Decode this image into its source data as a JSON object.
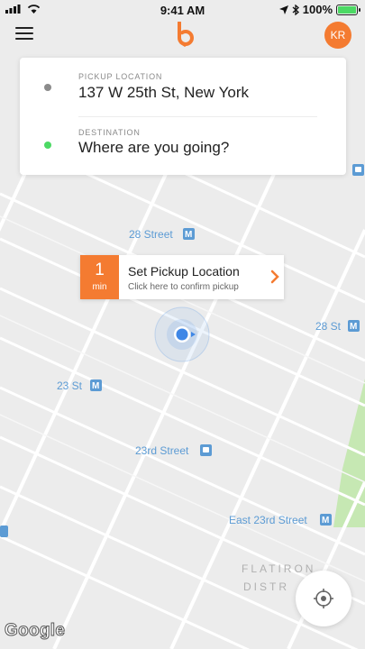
{
  "status_bar": {
    "time": "9:41 AM",
    "battery_percent": "100%",
    "battery_level": 1.0
  },
  "nav": {
    "menu_icon": "hamburger-icon",
    "logo_icon": "b-logo-icon",
    "avatar_initials": "KR",
    "brand_color": "#f47b31"
  },
  "location_card": {
    "pickup": {
      "label": "PICKUP LOCATION",
      "value": "137 W 25th St, New York",
      "dot_color": "#8b8b8b"
    },
    "destination": {
      "label": "DESTINATION",
      "value": "Where are you going?",
      "dot_color": "#4cd964"
    }
  },
  "pickup_callout": {
    "eta_number": "1",
    "eta_unit": "min",
    "title": "Set Pickup Location",
    "subtitle": "Click here to confirm pickup",
    "chevron_icon": "chevron-right-icon"
  },
  "map": {
    "labels": [
      {
        "text": "28 Street",
        "kind": "subway"
      },
      {
        "text": "28 St",
        "kind": "subway"
      },
      {
        "text": "23 St",
        "kind": "subway"
      },
      {
        "text": "23rd Street",
        "kind": "path"
      },
      {
        "text": "East 23rd Street",
        "kind": "subway"
      },
      {
        "text": "FLATIRON",
        "kind": "district"
      },
      {
        "text": "DISTR",
        "kind": "district"
      }
    ],
    "attribution": "Google",
    "recenter_icon": "crosshair-icon",
    "location_marker_icon": "location-arrow-icon"
  },
  "colors": {
    "map_bg": "#ececec",
    "road": "#ffffff",
    "park": "#c6e8b3",
    "transit_label": "#5c9bd4",
    "accent": "#f47b31"
  }
}
